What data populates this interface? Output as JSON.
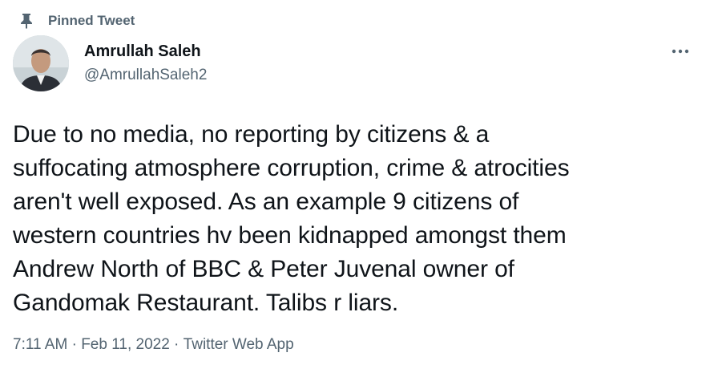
{
  "pinned": {
    "label": "Pinned Tweet",
    "icon": "pin-icon"
  },
  "author": {
    "name": "Amrullah Saleh",
    "handle": "@AmrullahSaleh2",
    "avatar_icon": "avatar"
  },
  "menu": {
    "icon": "more-dots-icon"
  },
  "tweet": {
    "text": "Due to no media,  no reporting by citizens & a\nsuffocating atmosphere corruption, crime & atrocities\naren't well exposed. As an example 9 citizens of\nwestern countries hv been kidnapped amongst them\nAndrew North of BBC & Peter Juvenal owner of\nGandomak Restaurant. Talibs r liars."
  },
  "meta": {
    "time": "7:11 AM",
    "separator": " · ",
    "date": "Feb 11, 2022",
    "source": "Twitter Web App"
  },
  "colors": {
    "text_primary": "#0f1419",
    "text_secondary": "#536471",
    "background": "#ffffff"
  }
}
